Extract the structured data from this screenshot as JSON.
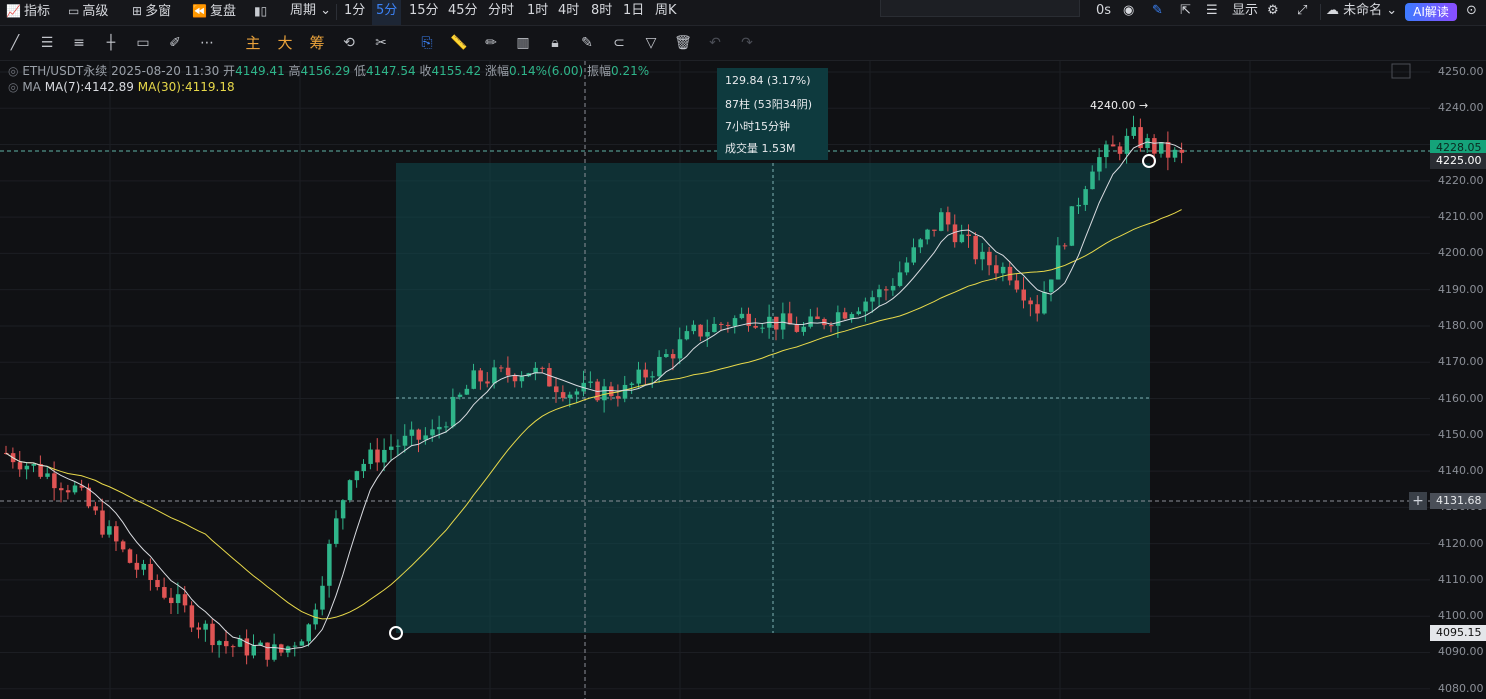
{
  "toolbar": {
    "indicators": "指标",
    "advanced": "高级",
    "multi_window": "多窗",
    "replay": "复盘",
    "period": "周期",
    "intervals": [
      "1分",
      "5分",
      "15分",
      "45分",
      "分时",
      "1时",
      "4时",
      "8时",
      "1日",
      "周K"
    ],
    "active_interval": "5分",
    "seconds": "0s",
    "display": "显示",
    "unnamed": "未命名",
    "ai_read": "AI解读"
  },
  "draw_tools": {
    "main": "主",
    "big": "大",
    "chips": "筹"
  },
  "legend": {
    "symbol": "ETH/USDT永续",
    "datetime": "2025-08-20 11:30",
    "open_label": "开",
    "open": "4149.41",
    "high_label": "高",
    "high": "4156.29",
    "low_label": "低",
    "low": "4147.54",
    "close_label": "收",
    "close": "4155.42",
    "change_label": "涨幅",
    "change": "0.14%(6.00)",
    "amp_label": "振幅",
    "amp": "0.21%",
    "ma_label": "MA",
    "ma7": "MA(7):4142.89",
    "ma30": "MA(30):4119.18"
  },
  "measure": {
    "change": "129.84 (3.17%)",
    "bars": "87柱 (53阳34阴)",
    "duration": "7小时15分钟",
    "volume": "成交量 1.53M"
  },
  "peak_label": "4240.00 →",
  "y_axis": {
    "ticks": [
      "4250.00",
      "4240.00",
      "4230.00",
      "4220.00",
      "4210.00",
      "4200.00",
      "4190.00",
      "4180.00",
      "4170.00",
      "4160.00",
      "4150.00",
      "4140.00",
      "4130.00",
      "4120.00",
      "4110.00",
      "4100.00",
      "4090.00",
      "4080.00"
    ],
    "last_price": "4228.05",
    "current_price": "4225.00",
    "crosshair_price": "4131.68",
    "range_low_price": "4095.15"
  },
  "colors": {
    "up": "#2fb58a",
    "down": "#e05454",
    "ma7": "#d9dbe0",
    "ma30": "#e8d94a",
    "accent": "#3b82f6",
    "measure_fill": "#0f4b4f"
  }
}
